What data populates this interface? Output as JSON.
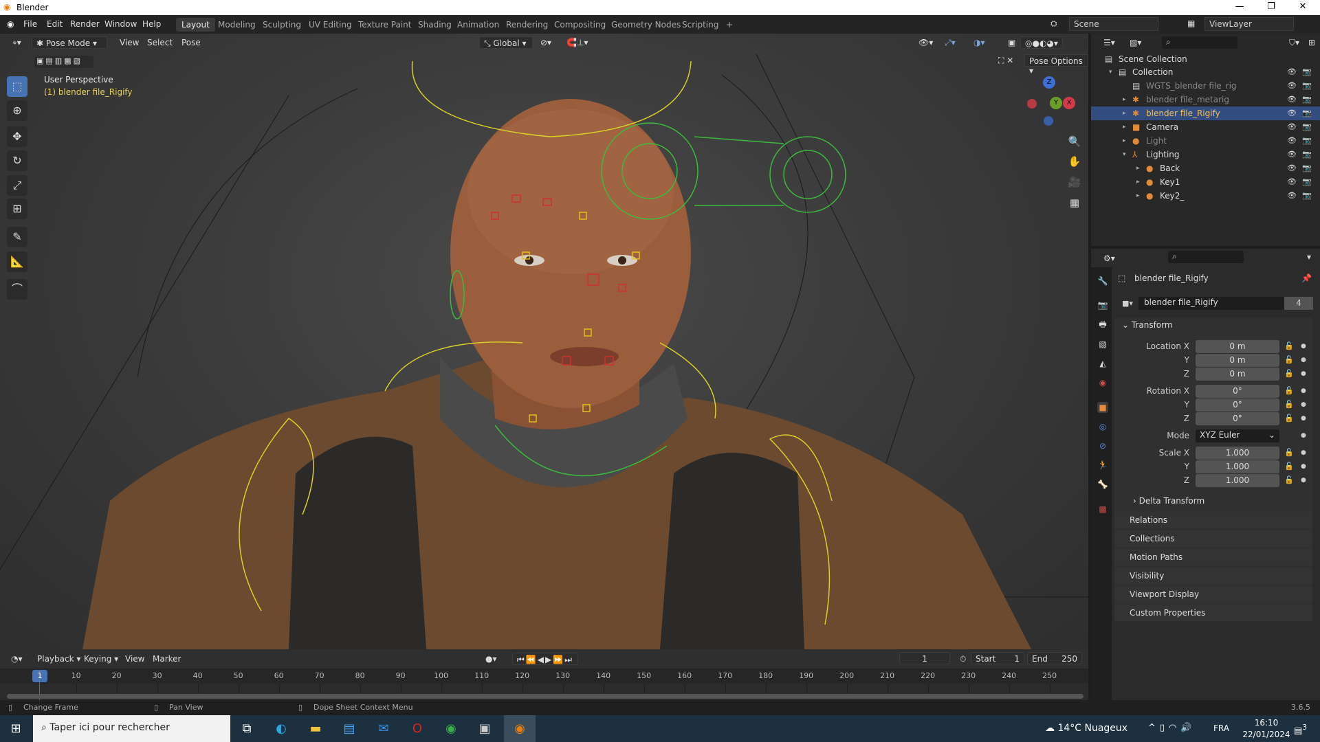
{
  "window": {
    "title": "Blender",
    "controls": [
      "—",
      "❐",
      "✕"
    ]
  },
  "menu": [
    "File",
    "Edit",
    "Render",
    "Window",
    "Help"
  ],
  "workspaces": [
    "Layout",
    "Modeling",
    "Sculpting",
    "UV Editing",
    "Texture Paint",
    "Shading",
    "Animation",
    "Rendering",
    "Compositing",
    "Geometry Nodes",
    "Scripting",
    "+"
  ],
  "scene": {
    "scene_name": "Scene",
    "view_layer": "ViewLayer"
  },
  "viewport": {
    "mode": "Pose Mode",
    "menus": [
      "View",
      "Select",
      "Pose"
    ],
    "orientation": "Global",
    "pose_options": "Pose Options",
    "overlay_title": "User Perspective",
    "overlay_object": "(1) blender file_Rigify",
    "gizmo_axes": [
      "Z",
      "Y",
      "X"
    ]
  },
  "outliner": {
    "rows": [
      {
        "name": "Scene Collection",
        "indent": 0,
        "icon": "▤",
        "color": "#ddd"
      },
      {
        "name": "Collection",
        "indent": 1,
        "icon": "▤",
        "color": "#ddd",
        "arrow": "▾"
      },
      {
        "name": "WGTS_blender file_rig",
        "indent": 2,
        "icon": "▤",
        "color": "#888"
      },
      {
        "name": "blender file_metarig",
        "indent": 2,
        "icon": "✱",
        "color": "#888",
        "arrow": "▸"
      },
      {
        "name": "blender file_Rigify",
        "indent": 2,
        "icon": "✱",
        "color": "#f0c060",
        "arrow": "▸",
        "selected": true
      },
      {
        "name": "Camera",
        "indent": 2,
        "icon": "■",
        "color": "#ddd",
        "arrow": "▸"
      },
      {
        "name": "Light",
        "indent": 2,
        "icon": "●",
        "color": "#888",
        "arrow": "▸"
      },
      {
        "name": "Lighting",
        "indent": 2,
        "icon": "⅄",
        "color": "#ddd",
        "arrow": "▾"
      },
      {
        "name": "Back",
        "indent": 3,
        "icon": "●",
        "color": "#ddd",
        "arrow": "▸"
      },
      {
        "name": "Key1",
        "indent": 3,
        "icon": "●",
        "color": "#ddd",
        "arrow": "▸"
      },
      {
        "name": "Key2_",
        "indent": 3,
        "icon": "●",
        "color": "#ddd",
        "arrow": "▸"
      }
    ]
  },
  "properties": {
    "object_name": "blender file_Rigify",
    "data_name": "blender file_Rigify",
    "users": "4",
    "transform_label": "Transform",
    "location": {
      "label": "Location X",
      "x": "0 m",
      "y": "0 m",
      "z": "0 m"
    },
    "rotation": {
      "label": "Rotation X",
      "x": "0°",
      "y": "0°",
      "z": "0°"
    },
    "mode": {
      "label": "Mode",
      "value": "XYZ Euler"
    },
    "scale": {
      "label": "Scale X",
      "x": "1.000",
      "y": "1.000",
      "z": "1.000"
    },
    "axis_y": "Y",
    "axis_z": "Z",
    "sections": [
      "Delta Transform",
      "Relations",
      "Collections",
      "Motion Paths",
      "Visibility",
      "Viewport Display",
      "Custom Properties"
    ]
  },
  "timeline": {
    "menus": [
      "Playback",
      "Keying",
      "View",
      "Marker"
    ],
    "current_frame": "1",
    "start_label": "Start",
    "start": "1",
    "end_label": "End",
    "end": "250",
    "ticks": [
      "10",
      "20",
      "30",
      "40",
      "50",
      "60",
      "70",
      "80",
      "90",
      "100",
      "110",
      "120",
      "130",
      "140",
      "150",
      "160",
      "170",
      "180",
      "190",
      "200",
      "210",
      "220",
      "230",
      "240",
      "250"
    ]
  },
  "status": {
    "items": [
      "Change Frame",
      "Pan View",
      "Dope Sheet Context Menu"
    ],
    "version": "3.6.5"
  },
  "taskbar": {
    "search_placeholder": "Taper ici pour rechercher",
    "weather": "14°C  Nuageux",
    "language": "FRA",
    "time": "16:10",
    "date": "22/01/2024",
    "notifications": "3"
  },
  "colors": {
    "accent": "#4772b3",
    "selection": "#334d80",
    "active_text": "#f0c060",
    "overlay_text": "#e6d15a"
  }
}
